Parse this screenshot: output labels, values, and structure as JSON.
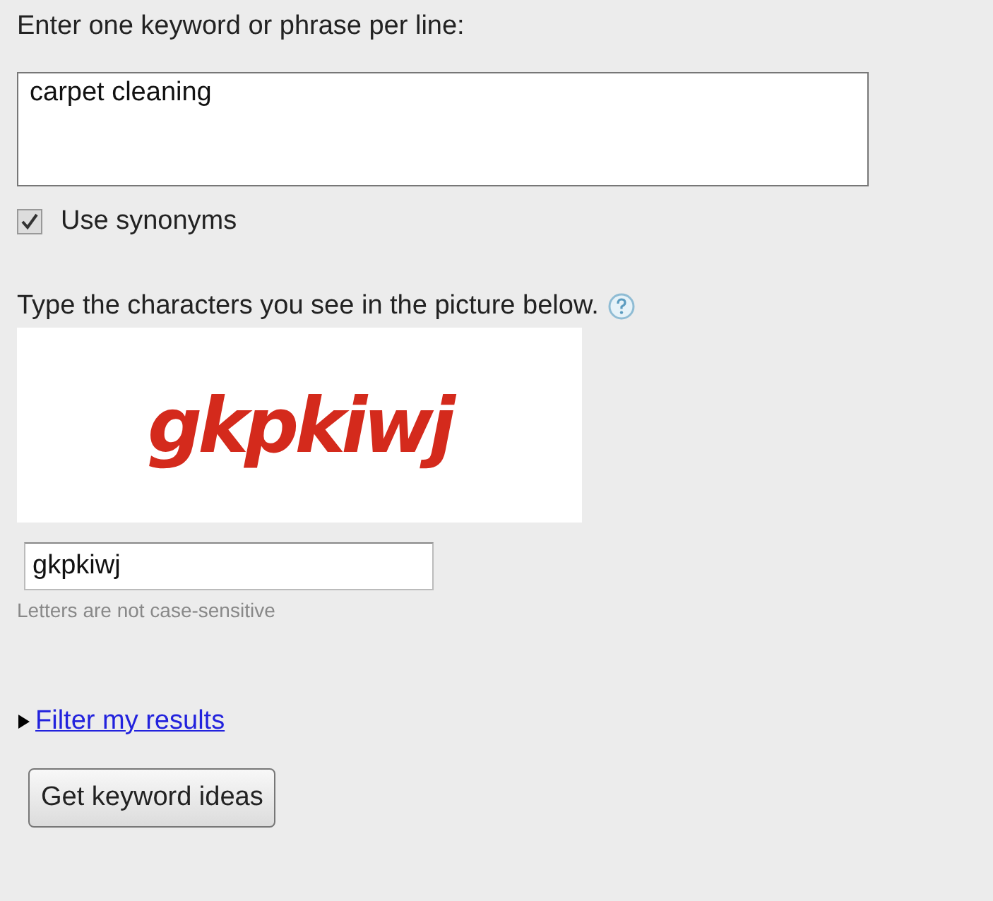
{
  "keywords": {
    "label": "Enter one keyword or phrase per line:",
    "value": "carpet cleaning"
  },
  "synonyms": {
    "label": "Use synonyms",
    "checked": true
  },
  "captcha": {
    "prompt": "Type the characters you see in the picture below.",
    "image_text": "gkpkiwj",
    "value": "gkpkiwj",
    "hint": "Letters are not case-sensitive"
  },
  "filter": {
    "label": "Filter my results",
    "expanded": false
  },
  "buttons": [
    "Get keyword ideas"
  ]
}
